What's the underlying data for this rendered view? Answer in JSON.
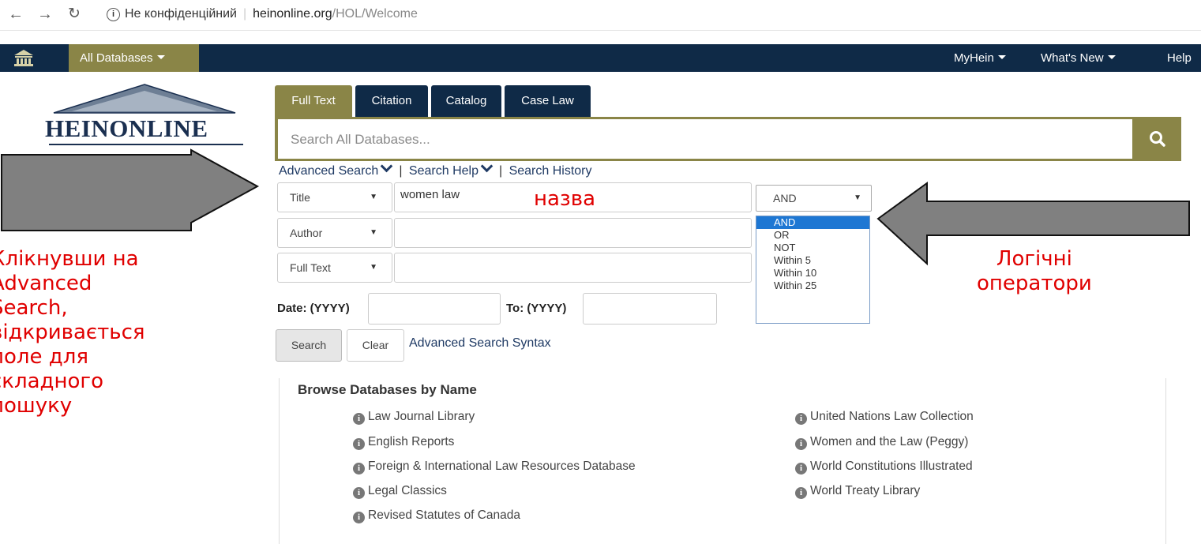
{
  "browser": {
    "privacy_label": "Не конфіденційний",
    "url_host": "heinonline.org",
    "url_path": "/HOL/Welcome"
  },
  "navbar": {
    "all_databases": "All Databases",
    "myhein": "MyHein",
    "whats_new": "What's New",
    "help": "Help"
  },
  "logo": {
    "text": "HEINONLINE"
  },
  "tabs": [
    {
      "label": "Full Text",
      "active": true
    },
    {
      "label": "Citation",
      "active": false
    },
    {
      "label": "Catalog",
      "active": false
    },
    {
      "label": "Case Law",
      "active": false
    }
  ],
  "search": {
    "placeholder": "Search All Databases...",
    "links": {
      "advanced": "Advanced Search",
      "help": "Search Help",
      "history": "Search History"
    }
  },
  "advanced": {
    "rows": [
      {
        "field": "Title",
        "value": "women law",
        "operator": "AND"
      },
      {
        "field": "Author",
        "value": ""
      },
      {
        "field": "Full Text",
        "value": ""
      }
    ],
    "operator_options": [
      "AND",
      "OR",
      "NOT",
      "Within 5",
      "Within 10",
      "Within 25"
    ],
    "selected_operator": "AND",
    "date_from_label": "Date: (YYYY)",
    "date_to_label": "To: (YYYY)",
    "search_button": "Search",
    "clear_button": "Clear",
    "syntax_link": "Advanced Search Syntax"
  },
  "browse": {
    "title": "Browse Databases by Name",
    "left": [
      "Law Journal Library",
      "English Reports",
      "Foreign & International Law Resources Database",
      "Legal Classics",
      "Revised Statutes of Canada"
    ],
    "right": [
      "United Nations Law Collection",
      "Women and the Law (Peggy)",
      "World Constitutions Illustrated",
      "World Treaty Library"
    ]
  },
  "annotations": {
    "left": "Клікнувши на\nAdvanced\nSearch,\nвідкривається\nполе для\nскладного\nпошуку",
    "right": "Логічні\nоператори",
    "title_label": "назва"
  },
  "colors": {
    "navbar": "#0f2a47",
    "accent": "#8a8547",
    "annotation": "#e00000",
    "arrow_fill": "#808080"
  }
}
